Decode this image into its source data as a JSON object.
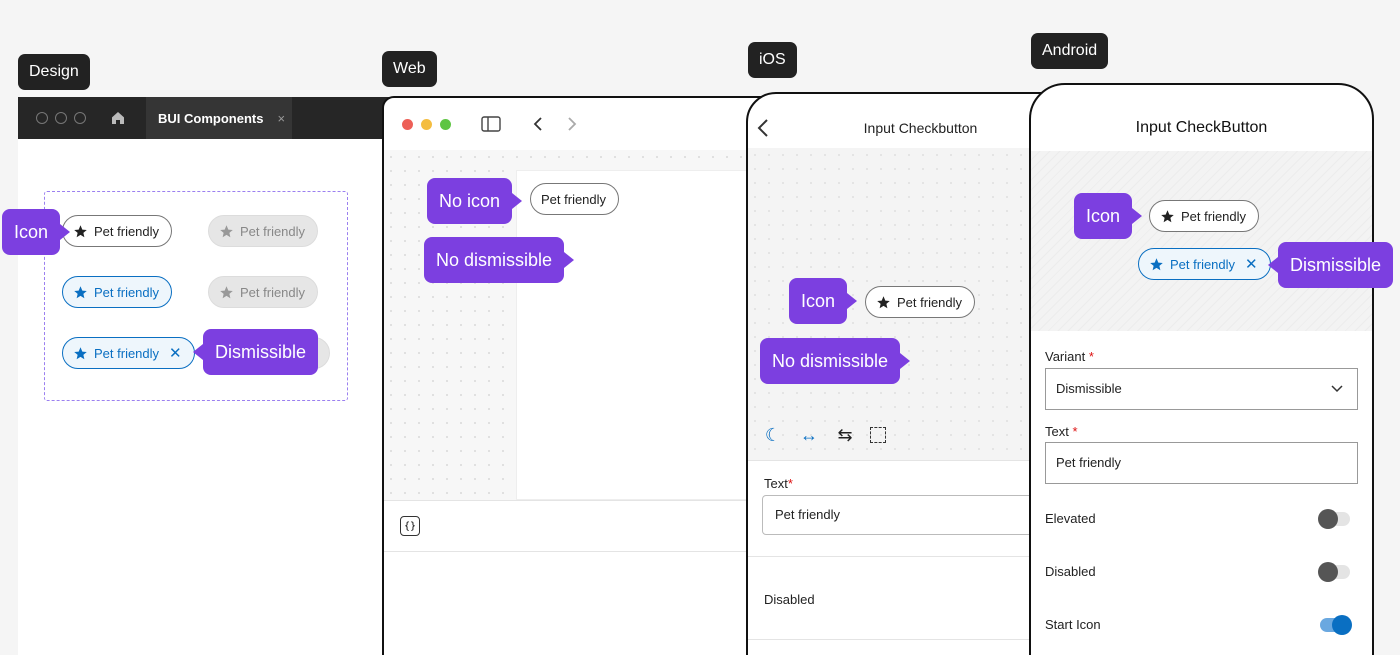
{
  "labels": {
    "design": "Design",
    "web": "Web",
    "ios": "iOS",
    "android": "Android"
  },
  "design": {
    "tab_title": "BUI Components",
    "tab_close": "×",
    "chip_text": "Pet friendly",
    "callouts": {
      "icon": "Icon",
      "dismissible": "Dismissible"
    },
    "close": "✕"
  },
  "web": {
    "chip_text": "Pet friendly",
    "callouts": {
      "no_icon": "No icon",
      "no_dismissible": "No dismissible"
    },
    "code_icon": "{}"
  },
  "ios": {
    "title": "Input Checkbutton",
    "chip_text": "Pet friendly",
    "callouts": {
      "icon": "Icon",
      "no_dismissible": "No dismissible"
    },
    "text_label": "Text",
    "required_mark": "*",
    "text_value": "Pet friendly",
    "disabled_label": "Disabled"
  },
  "android": {
    "title": "Input CheckButton",
    "chip_text": "Pet friendly",
    "callouts": {
      "icon": "Icon",
      "dismissible": "Dismissible"
    },
    "close": "✕",
    "variant_label": "Variant",
    "required_mark": "*",
    "variant_value": "Dismissible",
    "text_label": "Text",
    "text_value": "Pet friendly",
    "toggles": [
      {
        "label": "Elevated",
        "on": false
      },
      {
        "label": "Disabled",
        "on": false
      },
      {
        "label": "Start Icon",
        "on": true
      }
    ]
  },
  "colors": {
    "callout": "#7c3fe0",
    "accent": "#0a6fc2",
    "label_bg": "#222222"
  }
}
